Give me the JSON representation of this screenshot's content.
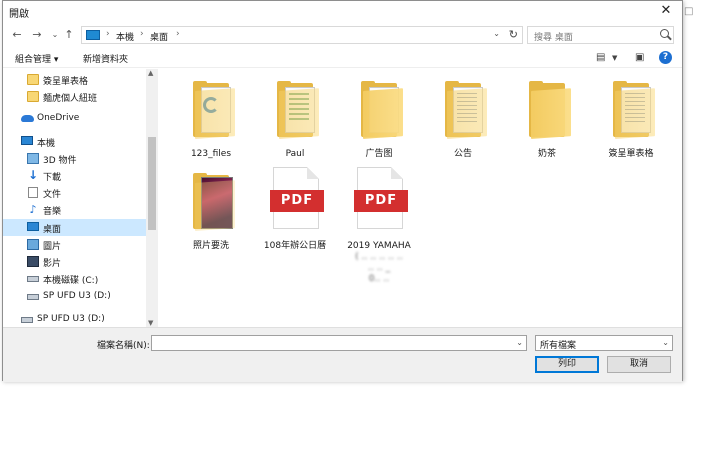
{
  "dialog": {
    "title": "開啟"
  },
  "address": {
    "segments": [
      "本機",
      "桌面"
    ]
  },
  "search": {
    "placeholder": "搜尋 桌面"
  },
  "toolbar": {
    "organize": "組合管理 ▾",
    "new_folder": "新增資料夾"
  },
  "sidebar": {
    "items": [
      {
        "label": "簽呈單表格",
        "icon": "folder-icon"
      },
      {
        "label": "麵虎個人紐班",
        "icon": "folder-icon"
      },
      {
        "label": "OneDrive",
        "icon": "onedrive-icon"
      },
      {
        "label": "本機",
        "icon": "computer-icon"
      },
      {
        "label": "3D 物件",
        "icon": "3d-objects-icon"
      },
      {
        "label": "下載",
        "icon": "download-icon"
      },
      {
        "label": "文件",
        "icon": "documents-icon"
      },
      {
        "label": "音樂",
        "icon": "music-icon"
      },
      {
        "label": "桌面",
        "icon": "desktop-icon",
        "selected": true
      },
      {
        "label": "圖片",
        "icon": "pictures-icon"
      },
      {
        "label": "影片",
        "icon": "videos-icon"
      },
      {
        "label": "本機磁碟 (C:)",
        "icon": "drive-icon"
      },
      {
        "label": "SP UFD U3 (D:)",
        "icon": "usb-drive-icon"
      },
      {
        "label": "SP UFD U3 (D:)",
        "icon": "usb-drive-icon"
      }
    ]
  },
  "files": [
    {
      "name": "123_files",
      "type": "folder-edge"
    },
    {
      "name": "Paul",
      "type": "folder-sheet"
    },
    {
      "name": "广告图",
      "type": "folder-plain"
    },
    {
      "name": "公告",
      "type": "folder-doc"
    },
    {
      "name": "奶茶",
      "type": "folder-plain"
    },
    {
      "name": "簽呈單表格",
      "type": "folder-doc"
    },
    {
      "name": "照片要洗",
      "type": "folder-photo"
    },
    {
      "name": "108年辦公日曆",
      "type": "pdf",
      "badge": "PDF"
    },
    {
      "name": "2019 YAMAHA",
      "type": "pdf",
      "badge": "PDF"
    }
  ],
  "footer": {
    "filename_label": "檔案名稱(N):",
    "filename_value": "",
    "filetype": "所有檔案",
    "open_label": "列印",
    "cancel_label": "取消"
  }
}
